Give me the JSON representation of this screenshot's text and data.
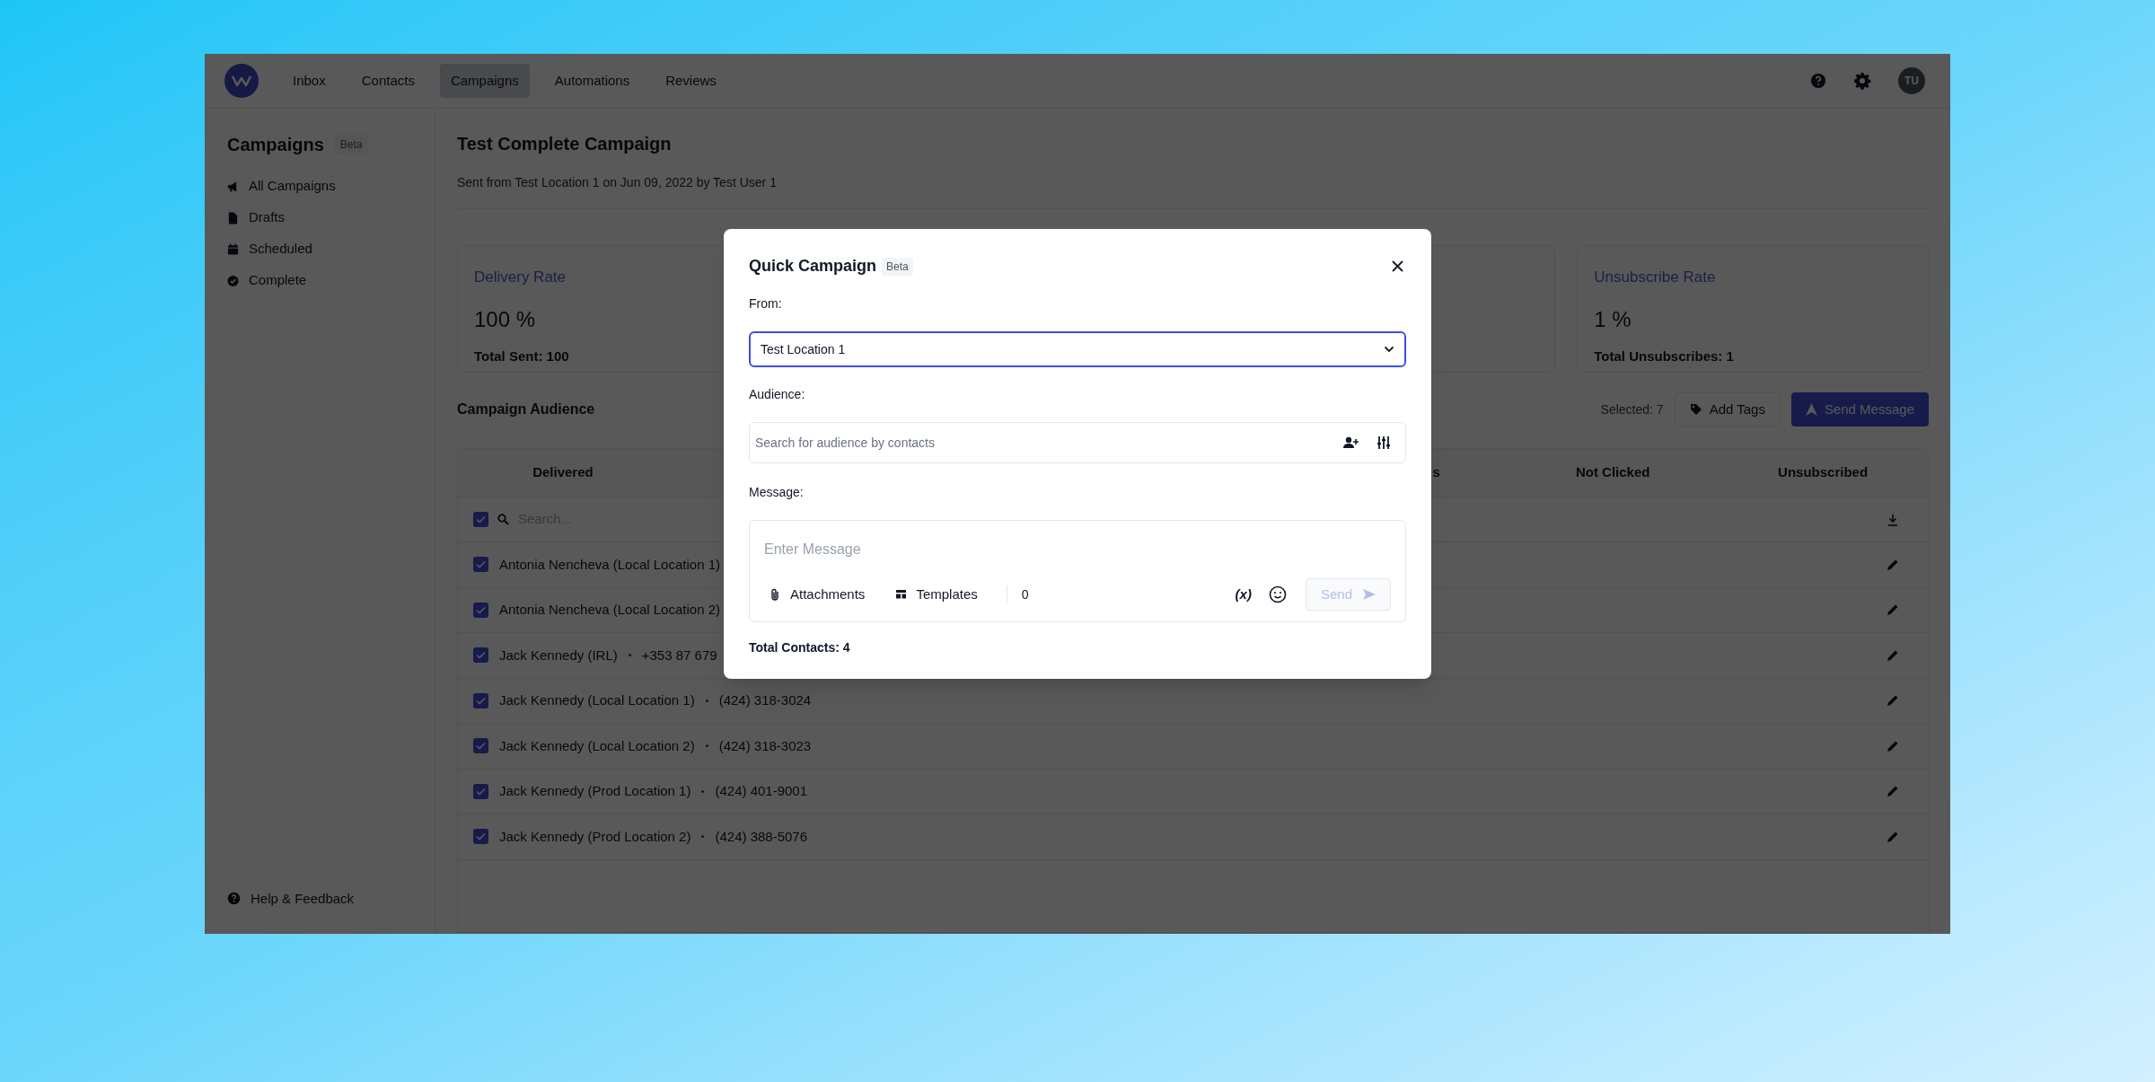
{
  "nav": {
    "items": [
      {
        "label": "Inbox",
        "selected": false
      },
      {
        "label": "Contacts",
        "selected": false
      },
      {
        "label": "Campaigns",
        "selected": true
      },
      {
        "label": "Automations",
        "selected": false
      },
      {
        "label": "Reviews",
        "selected": false
      }
    ],
    "avatar": "TU"
  },
  "sidebar": {
    "title": "Campaigns",
    "badge": "Beta",
    "items": [
      {
        "label": "All Campaigns"
      },
      {
        "label": "Drafts"
      },
      {
        "label": "Scheduled"
      },
      {
        "label": "Complete"
      }
    ],
    "footer": "Help & Feedback"
  },
  "campaign": {
    "title": "Test Complete Campaign",
    "subtitle": "Sent from Test Location 1 on Jun 09, 2022 by Test User 1"
  },
  "stats": [
    {
      "label": "Delivery Rate",
      "value": "100 %",
      "total": "Total Sent: 100"
    },
    {
      "label": "Unsubscribe Rate",
      "value": "1 %",
      "total": "Total Unsubscribes: 1"
    }
  ],
  "audience": {
    "title": "Campaign Audience",
    "selected_count": "Selected: 7",
    "buttons": [
      "Add Tags",
      "Send Message"
    ]
  },
  "table": {
    "columns": [
      {
        "label": "Delivered",
        "kind": "full"
      },
      {
        "label": "s",
        "kind": "clipped"
      },
      {
        "label": "Not Clicked",
        "kind": "full"
      },
      {
        "label": "Unsubscribed",
        "kind": "full"
      }
    ],
    "search": {
      "placeholder": "Search...",
      "checked": true
    },
    "rows": [
      {
        "name": "Antonia Nencheva (Local Location 1)",
        "checked": true
      },
      {
        "name": "Antonia Nencheva (Local Location 2)",
        "checked": true
      },
      {
        "name": "Jack Kennedy (IRL)",
        "phone": "+353 87 679",
        "checked": true
      },
      {
        "name": "Jack Kennedy (Local Location 1)",
        "phone": "(424) 318-3024",
        "checked": true
      },
      {
        "name": "Jack Kennedy (Local Location 2)",
        "phone": "(424) 318-3023",
        "checked": true
      },
      {
        "name": "Jack Kennedy (Prod Location 1)",
        "phone": "(424) 401-9001",
        "checked": true
      },
      {
        "name": "Jack Kennedy (Prod Location 2)",
        "phone": "(424) 388-5076",
        "checked": true
      }
    ]
  },
  "modal": {
    "title": "Quick Campaign",
    "badge": "Beta",
    "from": {
      "label": "From:",
      "value": "Test Location 1"
    },
    "audience": {
      "label": "Audience:",
      "placeholder": "Search for audience by contacts"
    },
    "message": {
      "label": "Message:",
      "placeholder": "Enter Message"
    },
    "tools": [
      "Attachments",
      "Templates"
    ],
    "char_count": "0",
    "variable_button": "(x)",
    "send": {
      "label": "Send",
      "disabled": true
    },
    "total": "Total Contacts: 4"
  }
}
